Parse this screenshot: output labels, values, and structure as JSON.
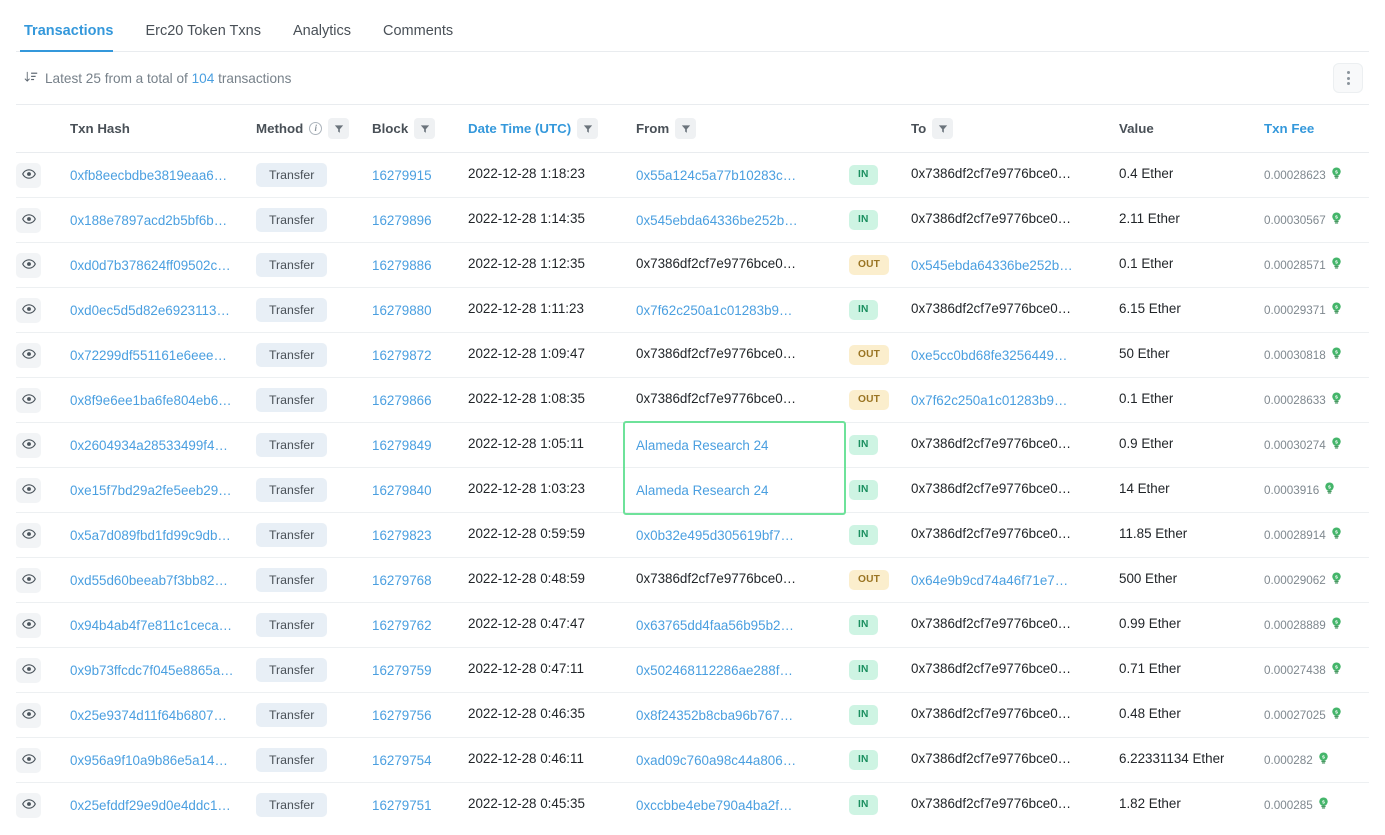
{
  "tabs": [
    {
      "label": "Transactions",
      "active": true
    },
    {
      "label": "Erc20 Token Txns",
      "active": false
    },
    {
      "label": "Analytics",
      "active": false
    },
    {
      "label": "Comments",
      "active": false
    }
  ],
  "summary": {
    "prefix": "Latest 25 from a total of",
    "count": "104",
    "suffix": "transactions",
    "sort_icon": "sort-descending-icon",
    "menu_icon": "kebab-menu-icon"
  },
  "columns": {
    "txn_hash": "Txn Hash",
    "method": "Method",
    "block": "Block",
    "date_time": "Date Time (UTC)",
    "from": "From",
    "to": "To",
    "value": "Value",
    "txn_fee": "Txn Fee"
  },
  "colors": {
    "link": "#4a9fe0",
    "accent": "#3498db",
    "in_badge_bg": "#cef4e3",
    "in_badge_text": "#1a8f5f",
    "out_badge_bg": "#fbeecd",
    "out_badge_text": "#9a7422",
    "method_pill_bg": "#e8eff6",
    "highlight_border": "#6ee29a"
  },
  "highlight": {
    "label": "alameda-research-highlight",
    "rows": [
      6,
      7
    ]
  },
  "rows": [
    {
      "hash": "0xfb8eecbdbe3819eaa6…",
      "method": "Transfer",
      "block": "16279915",
      "datetime": "2022-12-28 1:18:23",
      "from": "0x55a124c5a77b10283c…",
      "from_link": true,
      "dir": "IN",
      "to": "0x7386df2cf7e9776bce0…",
      "to_link": false,
      "value": "0.4 Ether",
      "fee": "0.00028623"
    },
    {
      "hash": "0x188e7897acd2b5bf6b…",
      "method": "Transfer",
      "block": "16279896",
      "datetime": "2022-12-28 1:14:35",
      "from": "0x545ebda64336be252b…",
      "from_link": true,
      "dir": "IN",
      "to": "0x7386df2cf7e9776bce0…",
      "to_link": false,
      "value": "2.11 Ether",
      "fee": "0.00030567"
    },
    {
      "hash": "0xd0d7b378624ff09502c…",
      "method": "Transfer",
      "block": "16279886",
      "datetime": "2022-12-28 1:12:35",
      "from": "0x7386df2cf7e9776bce0…",
      "from_link": false,
      "dir": "OUT",
      "to": "0x545ebda64336be252b…",
      "to_link": true,
      "value": "0.1 Ether",
      "fee": "0.00028571"
    },
    {
      "hash": "0xd0ec5d5d82e6923113…",
      "method": "Transfer",
      "block": "16279880",
      "datetime": "2022-12-28 1:11:23",
      "from": "0x7f62c250a1c01283b9…",
      "from_link": true,
      "dir": "IN",
      "to": "0x7386df2cf7e9776bce0…",
      "to_link": false,
      "value": "6.15 Ether",
      "fee": "0.00029371"
    },
    {
      "hash": "0x72299df551161e6eee…",
      "method": "Transfer",
      "block": "16279872",
      "datetime": "2022-12-28 1:09:47",
      "from": "0x7386df2cf7e9776bce0…",
      "from_link": false,
      "dir": "OUT",
      "to": "0xe5cc0bd68fe3256449…",
      "to_link": true,
      "value": "50 Ether",
      "fee": "0.00030818"
    },
    {
      "hash": "0x8f9e6ee1ba6fe804eb6…",
      "method": "Transfer",
      "block": "16279866",
      "datetime": "2022-12-28 1:08:35",
      "from": "0x7386df2cf7e9776bce0…",
      "from_link": false,
      "dir": "OUT",
      "to": "0x7f62c250a1c01283b9…",
      "to_link": true,
      "value": "0.1 Ether",
      "fee": "0.00028633"
    },
    {
      "hash": "0x2604934a28533499f4…",
      "method": "Transfer",
      "block": "16279849",
      "datetime": "2022-12-28 1:05:11",
      "from": "Alameda Research 24",
      "from_link": true,
      "dir": "IN",
      "to": "0x7386df2cf7e9776bce0…",
      "to_link": false,
      "value": "0.9 Ether",
      "fee": "0.00030274"
    },
    {
      "hash": "0xe15f7bd29a2fe5eeb29…",
      "method": "Transfer",
      "block": "16279840",
      "datetime": "2022-12-28 1:03:23",
      "from": "Alameda Research 24",
      "from_link": true,
      "dir": "IN",
      "to": "0x7386df2cf7e9776bce0…",
      "to_link": false,
      "value": "14 Ether",
      "fee": "0.0003916"
    },
    {
      "hash": "0x5a7d089fbd1fd99c9db…",
      "method": "Transfer",
      "block": "16279823",
      "datetime": "2022-12-28 0:59:59",
      "from": "0x0b32e495d305619bf7…",
      "from_link": true,
      "dir": "IN",
      "to": "0x7386df2cf7e9776bce0…",
      "to_link": false,
      "value": "11.85 Ether",
      "fee": "0.00028914"
    },
    {
      "hash": "0xd55d60beeab7f3bb82…",
      "method": "Transfer",
      "block": "16279768",
      "datetime": "2022-12-28 0:48:59",
      "from": "0x7386df2cf7e9776bce0…",
      "from_link": false,
      "dir": "OUT",
      "to": "0x64e9b9cd74a46f71e7…",
      "to_link": true,
      "value": "500 Ether",
      "fee": "0.00029062"
    },
    {
      "hash": "0x94b4ab4f7e811c1ceca…",
      "method": "Transfer",
      "block": "16279762",
      "datetime": "2022-12-28 0:47:47",
      "from": "0x63765dd4faa56b95b2…",
      "from_link": true,
      "dir": "IN",
      "to": "0x7386df2cf7e9776bce0…",
      "to_link": false,
      "value": "0.99 Ether",
      "fee": "0.00028889"
    },
    {
      "hash": "0x9b73ffcdc7f045e8865a…",
      "method": "Transfer",
      "block": "16279759",
      "datetime": "2022-12-28 0:47:11",
      "from": "0x502468112286ae288f…",
      "from_link": true,
      "dir": "IN",
      "to": "0x7386df2cf7e9776bce0…",
      "to_link": false,
      "value": "0.71 Ether",
      "fee": "0.00027438"
    },
    {
      "hash": "0x25e9374d11f64b6807…",
      "method": "Transfer",
      "block": "16279756",
      "datetime": "2022-12-28 0:46:35",
      "from": "0x8f24352b8cba96b767…",
      "from_link": true,
      "dir": "IN",
      "to": "0x7386df2cf7e9776bce0…",
      "to_link": false,
      "value": "0.48 Ether",
      "fee": "0.00027025"
    },
    {
      "hash": "0x956a9f10a9b86e5a14…",
      "method": "Transfer",
      "block": "16279754",
      "datetime": "2022-12-28 0:46:11",
      "from": "0xad09c760a98c44a806…",
      "from_link": true,
      "dir": "IN",
      "to": "0x7386df2cf7e9776bce0…",
      "to_link": false,
      "value": "6.22331134 Ether",
      "fee": "0.000282"
    },
    {
      "hash": "0x25efddf29e9d0e4ddc1…",
      "method": "Transfer",
      "block": "16279751",
      "datetime": "2022-12-28 0:45:35",
      "from": "0xccbbe4ebe790a4ba2f…",
      "from_link": true,
      "dir": "IN",
      "to": "0x7386df2cf7e9776bce0…",
      "to_link": false,
      "value": "1.82 Ether",
      "fee": "0.000285"
    }
  ]
}
